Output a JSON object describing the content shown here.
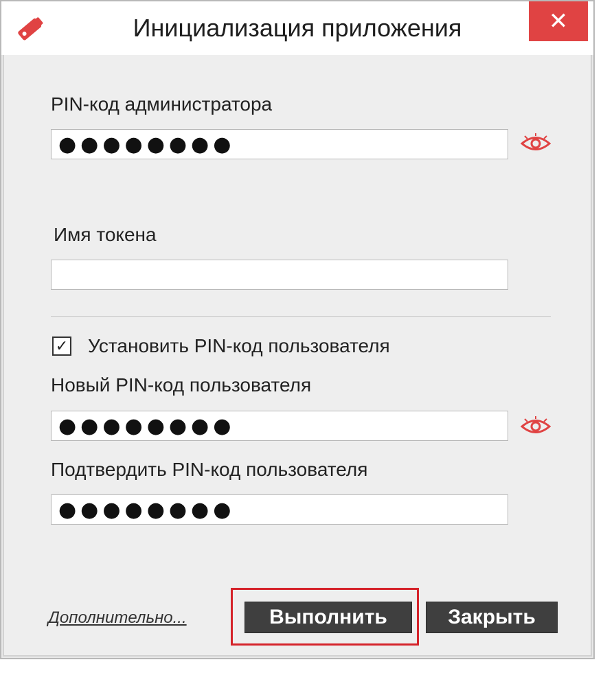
{
  "window": {
    "title": "Инициализация приложения",
    "close_symbol": "✕",
    "accent_color": "#e04343"
  },
  "admin_pin": {
    "label": "PIN-код администратора",
    "value": "●●●●●●●●",
    "reveal_icon": "eye-icon"
  },
  "token_name": {
    "label": "Имя токена",
    "value": ""
  },
  "set_user_pin": {
    "label": "Установить PIN-код пользователя",
    "checked": true,
    "check_mark": "✓"
  },
  "new_user_pin": {
    "label": "Новый PIN-код пользователя",
    "value": "●●●●●●●●",
    "reveal_icon": "eye-icon"
  },
  "confirm_user_pin": {
    "label": "Подтвердить PIN-код пользователя",
    "value": "●●●●●●●●"
  },
  "footer": {
    "more_link": "Дополнительно...",
    "execute_button": "Выполнить",
    "close_button": "Закрыть",
    "highlight_color": "#d5232a"
  }
}
